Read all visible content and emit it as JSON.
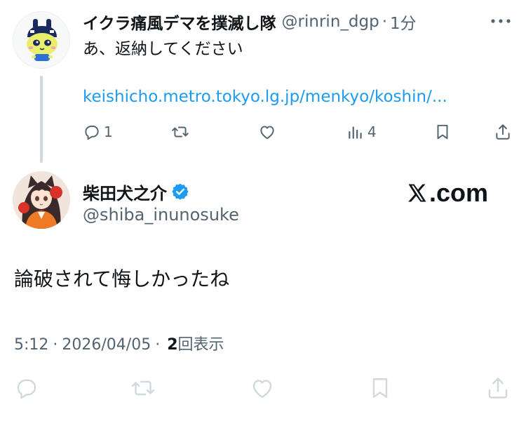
{
  "reply": {
    "display_name": "イクラ痛風デマを撲滅し隊",
    "handle": "@rinrin_dgp",
    "separator": "·",
    "time": "1分",
    "text": "あ、返納してください",
    "link": "keishicho.metro.tokyo.lg.jp/menkyo/koshin/...",
    "actions": {
      "reply_count": "1",
      "retweet_count": "",
      "like_count": "",
      "views_count": "4"
    },
    "icons": {
      "avatar": "tamagotchi-character-avatar",
      "more": "more-horizontal-icon",
      "reply": "reply-icon",
      "retweet": "retweet-icon",
      "like": "heart-icon",
      "views": "views-icon",
      "bookmark": "bookmark-icon",
      "share": "share-icon"
    }
  },
  "tweet": {
    "display_name": "柴田犬之介",
    "handle": "@shiba_inunosuke",
    "verified": true,
    "text": "論破されて悔しかったね",
    "time": "5:12",
    "separator": "·",
    "date": "2026/04/05",
    "views_count": "2",
    "views_label": "回表示",
    "icons": {
      "avatar": "anime-girl-avatar",
      "verified": "verified-badge-icon",
      "reply": "reply-icon",
      "retweet": "retweet-icon",
      "like": "heart-icon",
      "bookmark": "bookmark-icon",
      "share": "share-icon"
    }
  },
  "watermark": {
    "text": ".com"
  },
  "colors": {
    "link": "#1d9bf0",
    "secondary_text": "#536471",
    "primary_text": "#0f1419",
    "verified": "#1d9bf0",
    "thread_line": "#cfd9de",
    "muted_icon": "#cfd9de"
  }
}
